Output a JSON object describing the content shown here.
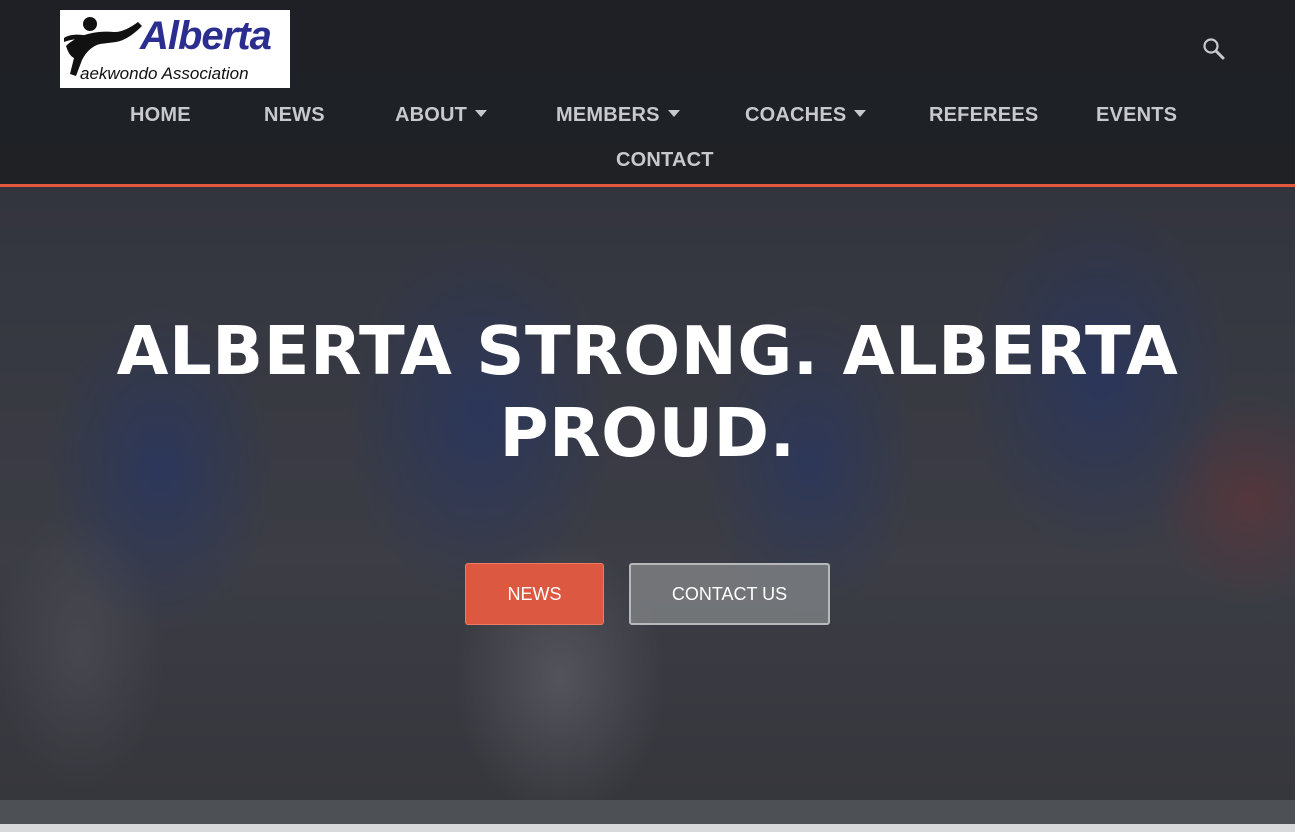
{
  "logo": {
    "title": "Alberta",
    "subtitle": "aekwondo Association",
    "mark_icon": "taekwondo-kicker-icon"
  },
  "header": {
    "search_icon": "search-icon"
  },
  "nav": {
    "home": "HOME",
    "news": "NEWS",
    "about": "ABOUT",
    "members": "MEMBERS",
    "coaches": "COACHES",
    "referees": "REFEREES",
    "events": "EVENTS",
    "contact": "CONTACT"
  },
  "hero": {
    "title_line1": "ALBERTA STRONG. ALBERTA",
    "title_line2": "PROUD.",
    "news_button": "NEWS",
    "contact_button": "CONTACT US"
  },
  "colors": {
    "accent": "#e2583e",
    "header_bg": "#1c1e22",
    "logo_blue": "#2b2d8f"
  }
}
